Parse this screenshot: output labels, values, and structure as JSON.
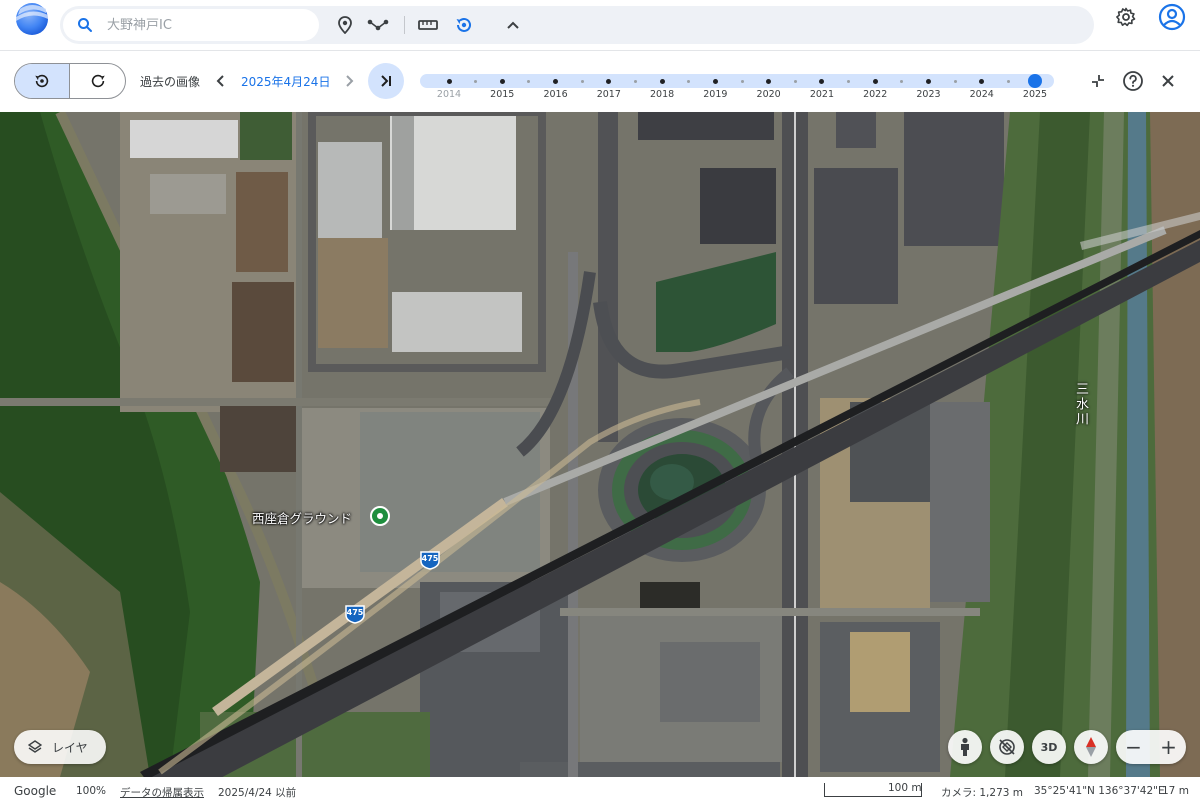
{
  "topbar": {
    "search": {
      "placeholder": "大野神戸IC"
    },
    "icons": [
      "pin-icon",
      "route-icon",
      "ruler-icon",
      "history-icon",
      "chevron-up-icon",
      "gear-icon",
      "account-icon"
    ]
  },
  "history": {
    "label": "過去の画像",
    "date": "2025年4月24日",
    "years": [
      "2014",
      "2015",
      "2016",
      "2017",
      "2018",
      "2019",
      "2020",
      "2021",
      "2022",
      "2023",
      "2024",
      "2025"
    ],
    "selected_year": "2025",
    "dim_years": [
      "2014"
    ]
  },
  "map": {
    "place_label": "西座倉グラウンド",
    "river_label": "三水川",
    "route_shields": [
      "475",
      "475"
    ]
  },
  "controls": {
    "layer_label": "レイヤ",
    "three_d_label": "3D",
    "zoom_out": "−",
    "zoom_in": "+"
  },
  "status": {
    "brand": "Google",
    "zoom": "100%",
    "attribution_link": "データの帰属表示",
    "imagery_date": "2025/4/24 以前",
    "scale_label": "100 m",
    "camera": "カメラ: 1,273 m",
    "coords": "35°25'41\"N 136°37'42\"E",
    "elevation": "17 m"
  },
  "colors": {
    "accent": "#1a73e8",
    "chip_bg": "#d3e3fd",
    "pin_green": "#1e8e3e",
    "shield_blue": "#1565c0"
  }
}
